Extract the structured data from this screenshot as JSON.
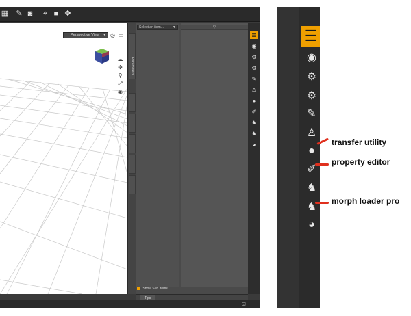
{
  "viewport": {
    "view_dropdown": "Perspective View"
  },
  "parameters_pane": {
    "tab_label": "Parameters",
    "item_select": "Select an item...",
    "show_sub_items": "Show Sub Items",
    "tips_tab": "Tips"
  },
  "icons": {
    "toolbar": [
      "render-settings-icon",
      "render-icon",
      "camera-icon",
      "spot-render-icon",
      "viewport-camera-icon",
      "transform-icon"
    ],
    "sidebar": [
      "parameters-icon",
      "target-icon",
      "scene-settings-icon",
      "gear-settings-icon",
      "edit-icon",
      "figure-edit-icon",
      "transfer-utility-icon",
      "property-editor-icon",
      "morph-loader-icon",
      "morph-loader-pro-icon",
      "globe-icon"
    ]
  },
  "colors": {
    "accent": "#f0a000",
    "callout": "#e0301e",
    "panel_dark": "#2b2b2b"
  },
  "callouts": [
    {
      "label": "transfer utility"
    },
    {
      "label": "property editor"
    },
    {
      "label": "morph loader pro"
    }
  ]
}
